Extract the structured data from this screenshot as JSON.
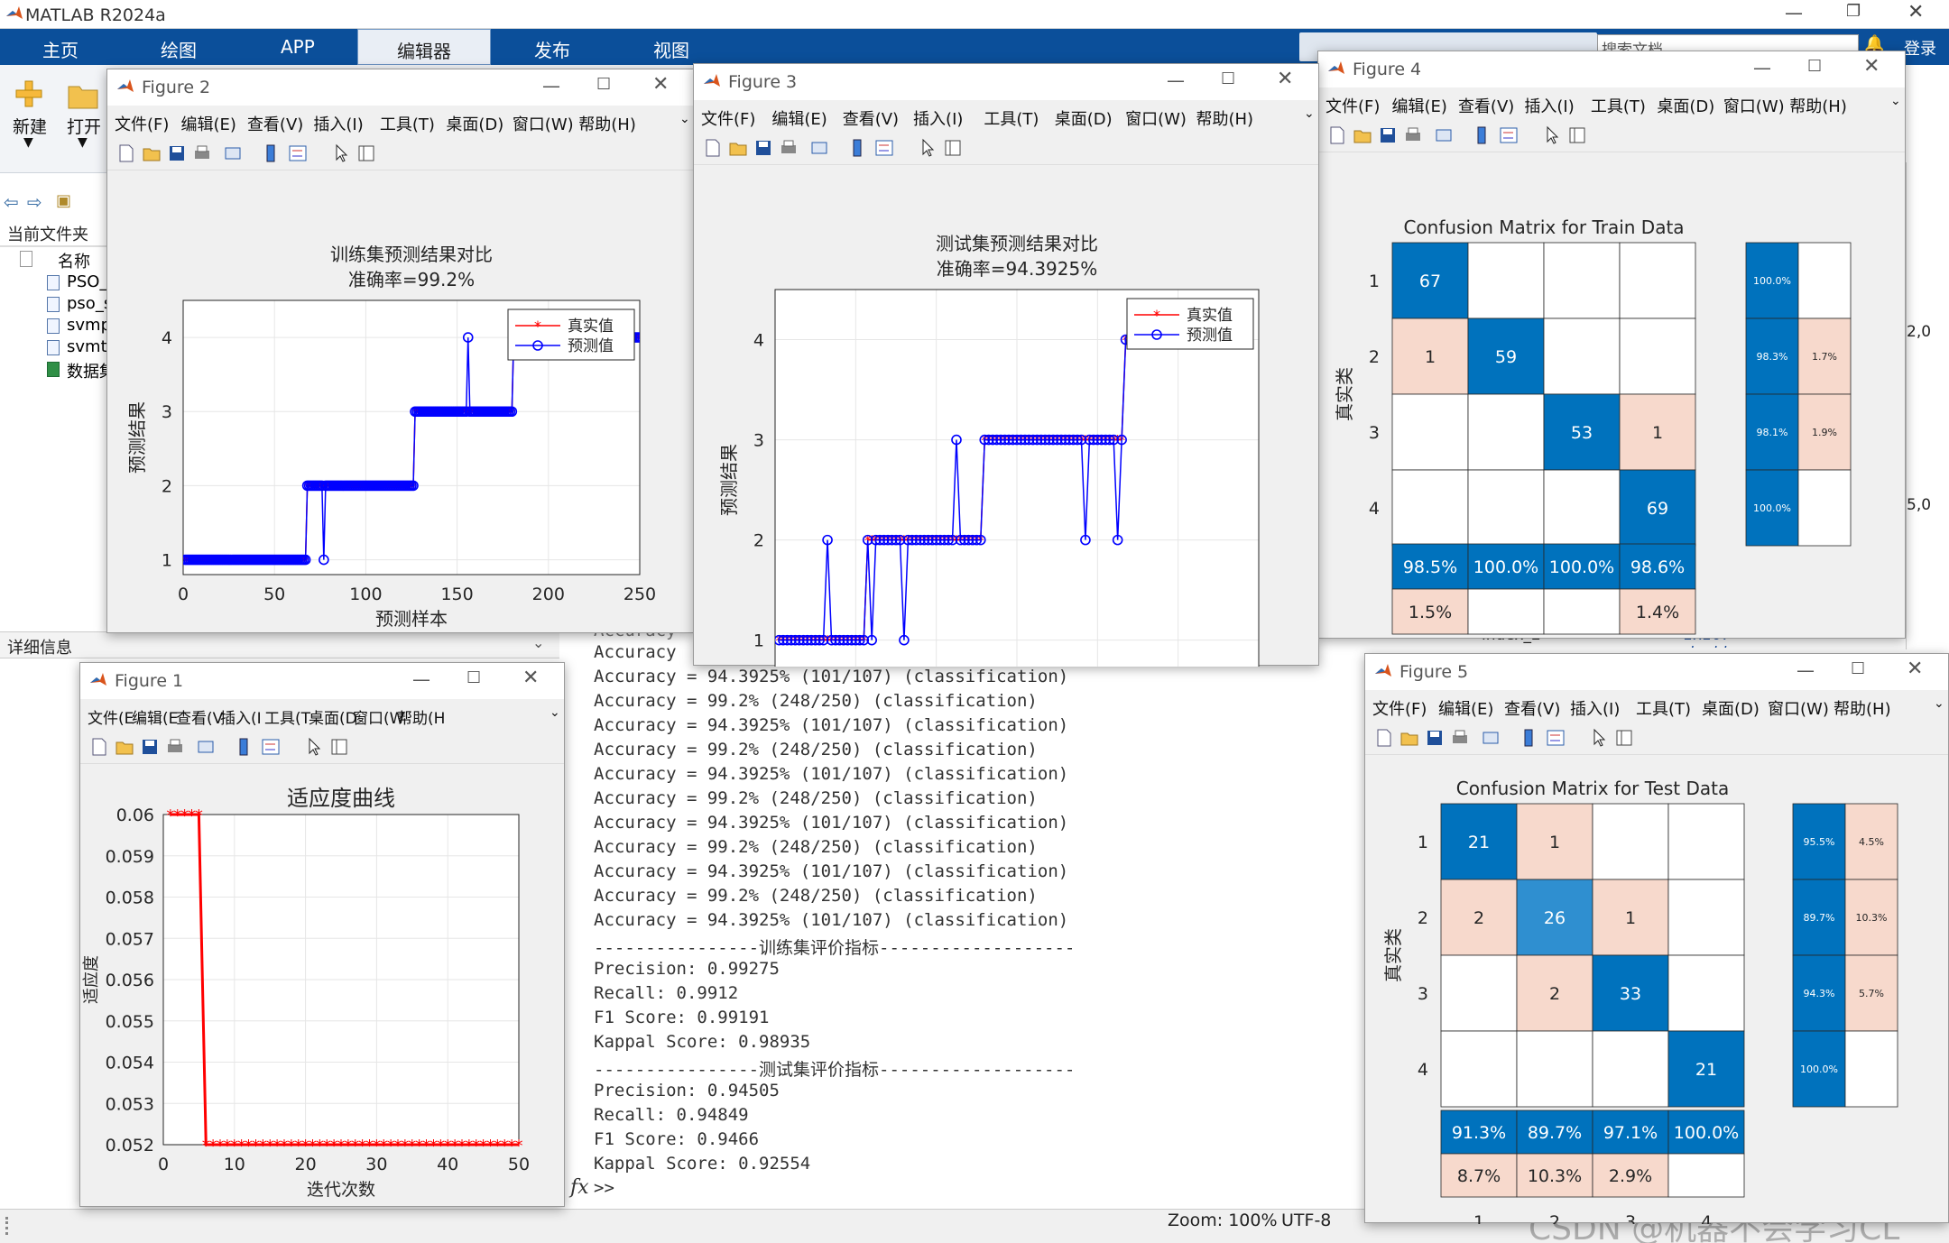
{
  "app": {
    "title": "MATLAB R2024a",
    "tabs": [
      "主页",
      "绘图",
      "APP",
      "编辑器",
      "发布",
      "视图"
    ],
    "active_tab": "编辑器",
    "search_placeholder": "搜索文档",
    "login": "登录"
  },
  "toolstrip": {
    "new_label": "新建",
    "open_label": "打开"
  },
  "files": {
    "current_folder_label": "当前文件夹",
    "name_header": "名称",
    "items": [
      "PSO_S",
      "pso_sv",
      "svmpre",
      "svmtra",
      "数据集"
    ],
    "details_label": "详细信息"
  },
  "workspace": {
    "partial_row": "index_2",
    "partial_type": "1x107 double",
    "partial_values": [
      "2,0",
      "5,0"
    ]
  },
  "command_window": {
    "partial_top": "Accuracy",
    "lines": [
      "Accuracy",
      "Accuracy = 94.3925% (101/107) (classification)",
      "Accuracy = 99.2% (248/250) (classification)",
      "Accuracy = 94.3925% (101/107) (classification)",
      "Accuracy = 99.2% (248/250) (classification)",
      "Accuracy = 94.3925% (101/107) (classification)",
      "Accuracy = 99.2% (248/250) (classification)",
      "Accuracy = 94.3925% (101/107) (classification)",
      "Accuracy = 99.2% (248/250) (classification)",
      "Accuracy = 94.3925% (101/107) (classification)",
      "Accuracy = 99.2% (248/250) (classification)",
      "Accuracy = 94.3925% (101/107) (classification)",
      "----------------训练集评价指标-------------------",
      "Precision: 0.99275",
      "Recall: 0.9912",
      "F1 Score: 0.99191",
      "Kappal Score: 0.98935",
      "----------------测试集评价指标-------------------",
      "Precision: 0.94505",
      "Recall: 0.94849",
      "F1 Score: 0.9466",
      "Kappal Score: 0.92554"
    ],
    "prompt_icon": "fx",
    "prompt": ">>"
  },
  "status": {
    "zoom": "Zoom: 100%",
    "encoding": "UTF-8",
    "watermark": "CSDN @机器不会学习CL"
  },
  "figure_menu": [
    "文件(F)",
    "编辑(E)",
    "查看(V)",
    "插入(I)",
    "工具(T)",
    "桌面(D)",
    "窗口(W)",
    "帮助(H)"
  ],
  "figure_menu_narrow": [
    "文件(E",
    "编辑(E",
    "查看(V",
    "插入(I",
    "工具(T",
    "桌面(D",
    "窗口(W",
    "帮助(H"
  ],
  "figures": {
    "fig1": {
      "title": "Figure 1",
      "chart_data": {
        "type": "line",
        "title": "适应度曲线",
        "xlabel": "迭代次数",
        "ylabel": "适应度",
        "xlim": [
          0,
          50
        ],
        "ylim": [
          0.052,
          0.06
        ],
        "xticks": [
          0,
          10,
          20,
          30,
          40,
          50
        ],
        "yticks": [
          0.052,
          0.053,
          0.054,
          0.055,
          0.056,
          0.057,
          0.058,
          0.059,
          0.06
        ],
        "series": [
          {
            "color": "#ff0000",
            "marker": "*",
            "x": [
              1,
              2,
              3,
              4,
              5,
              6,
              7,
              8,
              9,
              10,
              11,
              12,
              13,
              14,
              15,
              16,
              17,
              18,
              19,
              20,
              21,
              22,
              23,
              24,
              25,
              26,
              27,
              28,
              29,
              30,
              31,
              32,
              33,
              34,
              35,
              36,
              37,
              38,
              39,
              40,
              41,
              42,
              43,
              44,
              45,
              46,
              47,
              48,
              49,
              50
            ],
            "y": [
              0.06,
              0.06,
              0.06,
              0.06,
              0.06,
              0.052,
              0.052,
              0.052,
              0.052,
              0.052,
              0.052,
              0.052,
              0.052,
              0.052,
              0.052,
              0.052,
              0.052,
              0.052,
              0.052,
              0.052,
              0.052,
              0.052,
              0.052,
              0.052,
              0.052,
              0.052,
              0.052,
              0.052,
              0.052,
              0.052,
              0.052,
              0.052,
              0.052,
              0.052,
              0.052,
              0.052,
              0.052,
              0.052,
              0.052,
              0.052,
              0.052,
              0.052,
              0.052,
              0.052,
              0.052,
              0.052,
              0.052,
              0.052,
              0.052,
              0.052
            ]
          }
        ],
        "grid": true
      }
    },
    "fig2": {
      "title": "Figure 2",
      "chart_data": {
        "type": "line",
        "title": "训练集预测结果对比",
        "subtitle": "准确率=99.2%",
        "xlabel": "预测样本",
        "ylabel": "预测结果",
        "xlim": [
          0,
          250
        ],
        "ylim": [
          0.8,
          4.5
        ],
        "xticks": [
          0,
          50,
          100,
          150,
          200,
          250
        ],
        "yticks": [
          1,
          2,
          3,
          4
        ],
        "legend": [
          "真实值",
          "预测值"
        ],
        "legend_position": "top-right",
        "true_segments": [
          {
            "x0": 1,
            "x1": 67,
            "y": 1
          },
          {
            "x0": 68,
            "x1": 126,
            "y": 2
          },
          {
            "x0": 127,
            "x1": 180,
            "y": 3
          },
          {
            "x0": 181,
            "x1": 250,
            "y": 4
          }
        ],
        "pred_errors": [
          {
            "x": 77,
            "y": 1
          },
          {
            "x": 156,
            "y": 4
          }
        ],
        "grid": true
      }
    },
    "fig3": {
      "title": "Figure 3",
      "chart_data": {
        "type": "line",
        "title": "测试集预测结果对比",
        "subtitle": "准确率=94.3925%",
        "xlabel": "预测样本",
        "ylabel": "预测结果",
        "xlim": [
          0,
          120
        ],
        "ylim": [
          0.7,
          4.5
        ],
        "xticks": [
          0,
          20,
          40,
          60,
          80,
          100,
          120
        ],
        "yticks": [
          1,
          2,
          3,
          4
        ],
        "legend": [
          "真实值",
          "预测值"
        ],
        "legend_position": "top-right",
        "true_segments": [
          {
            "x0": 1,
            "x1": 22,
            "y": 1
          },
          {
            "x0": 23,
            "x1": 51,
            "y": 2
          },
          {
            "x0": 52,
            "x1": 86,
            "y": 3
          },
          {
            "x0": 87,
            "x1": 107,
            "y": 4
          }
        ],
        "pred_errors": [
          {
            "x": 13,
            "y": 2
          },
          {
            "x": 24,
            "y": 1
          },
          {
            "x": 32,
            "y": 1
          },
          {
            "x": 45,
            "y": 3
          },
          {
            "x": 77,
            "y": 2
          },
          {
            "x": 85,
            "y": 2
          }
        ],
        "grid": true
      }
    },
    "fig4": {
      "title": "Figure 4",
      "chart_data": {
        "type": "heatmap",
        "title": "Confusion Matrix for Train Data",
        "xlabel": "预测类",
        "ylabel": "真实类",
        "classes": [
          "1",
          "2",
          "3",
          "4"
        ],
        "matrix": [
          [
            67,
            0,
            0,
            0
          ],
          [
            1,
            59,
            0,
            0
          ],
          [
            0,
            0,
            53,
            1
          ],
          [
            0,
            0,
            0,
            69
          ]
        ],
        "row_summary": [
          [
            "100.0%",
            ""
          ],
          [
            "98.3%",
            "1.7%"
          ],
          [
            "98.1%",
            "1.9%"
          ],
          [
            "100.0%",
            ""
          ]
        ],
        "col_summary": [
          [
            "98.5%",
            "100.0%",
            "100.0%",
            "98.6%"
          ],
          [
            "1.5%",
            "",
            "",
            "1.4%"
          ]
        ]
      }
    },
    "fig5": {
      "title": "Figure 5",
      "chart_data": {
        "type": "heatmap",
        "title": "Confusion Matrix for Test Data",
        "xlabel": "预测类",
        "ylabel": "真实类",
        "classes": [
          "1",
          "2",
          "3",
          "4"
        ],
        "matrix": [
          [
            21,
            1,
            0,
            0
          ],
          [
            2,
            26,
            1,
            0
          ],
          [
            0,
            2,
            33,
            0
          ],
          [
            0,
            0,
            0,
            21
          ]
        ],
        "row_summary": [
          [
            "95.5%",
            "4.5%"
          ],
          [
            "89.7%",
            "10.3%"
          ],
          [
            "94.3%",
            "5.7%"
          ],
          [
            "100.0%",
            ""
          ]
        ],
        "col_summary": [
          [
            "91.3%",
            "89.7%",
            "97.1%",
            "100.0%"
          ],
          [
            "8.7%",
            "10.3%",
            "2.9%",
            ""
          ]
        ]
      }
    }
  },
  "colors": {
    "true_series": "#ff0000",
    "pred_series": "#0000ff",
    "diag": "#0072bd",
    "mid": "#2f8fd0",
    "off": "#f7d9cc",
    "tabbar": "#0b4f9a"
  }
}
